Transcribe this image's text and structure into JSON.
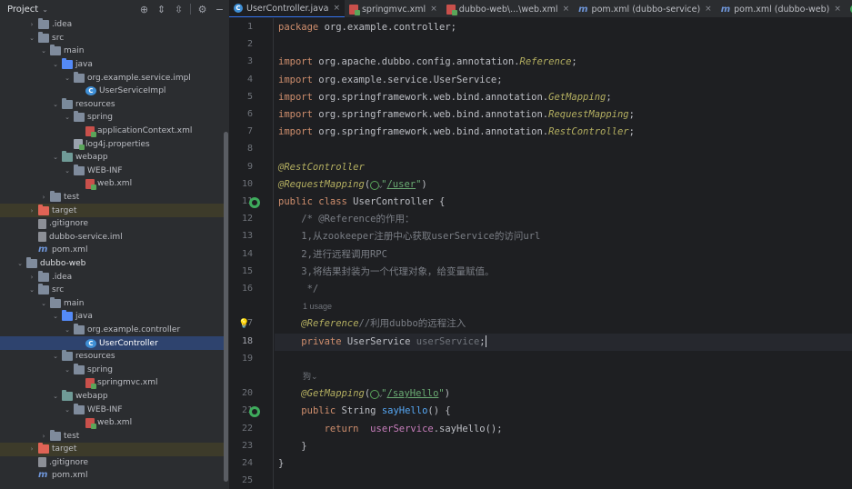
{
  "project_panel": {
    "title": "Project",
    "tree": [
      {
        "label": ".idea",
        "indent": 2,
        "arrow": "›",
        "icon": "folder"
      },
      {
        "label": "src",
        "indent": 2,
        "arrow": "⌄",
        "icon": "folder"
      },
      {
        "label": "main",
        "indent": 3,
        "arrow": "⌄",
        "icon": "folder"
      },
      {
        "label": "java",
        "indent": 4,
        "arrow": "⌄",
        "icon": "folder-blue"
      },
      {
        "label": "org.example.service.impl",
        "indent": 5,
        "arrow": "⌄",
        "icon": "folder"
      },
      {
        "label": "UserServiceImpl",
        "indent": 6,
        "arrow": "",
        "icon": "class"
      },
      {
        "label": "resources",
        "indent": 4,
        "arrow": "⌄",
        "icon": "folder-res"
      },
      {
        "label": "spring",
        "indent": 5,
        "arrow": "⌄",
        "icon": "folder"
      },
      {
        "label": "applicationContext.xml",
        "indent": 6,
        "arrow": "",
        "icon": "xml"
      },
      {
        "label": "log4j.properties",
        "indent": 5,
        "arrow": "",
        "icon": "properties"
      },
      {
        "label": "webapp",
        "indent": 4,
        "arrow": "⌄",
        "icon": "folder-teal"
      },
      {
        "label": "WEB-INF",
        "indent": 5,
        "arrow": "⌄",
        "icon": "folder"
      },
      {
        "label": "web.xml",
        "indent": 6,
        "arrow": "",
        "icon": "xml"
      },
      {
        "label": "test",
        "indent": 3,
        "arrow": "›",
        "icon": "folder"
      },
      {
        "label": "target",
        "indent": 2,
        "arrow": "›",
        "icon": "folder-red",
        "excluded": true
      },
      {
        "label": ".gitignore",
        "indent": 2,
        "arrow": "",
        "icon": "git"
      },
      {
        "label": "dubbo-service.iml",
        "indent": 2,
        "arrow": "",
        "icon": "iml"
      },
      {
        "label": "pom.xml",
        "indent": 2,
        "arrow": "",
        "icon": "maven"
      },
      {
        "label": "dubbo-web",
        "indent": 1,
        "arrow": "⌄",
        "icon": "folder-module",
        "bold": true
      },
      {
        "label": ".idea",
        "indent": 2,
        "arrow": "›",
        "icon": "folder"
      },
      {
        "label": "src",
        "indent": 2,
        "arrow": "⌄",
        "icon": "folder"
      },
      {
        "label": "main",
        "indent": 3,
        "arrow": "⌄",
        "icon": "folder"
      },
      {
        "label": "java",
        "indent": 4,
        "arrow": "⌄",
        "icon": "folder-blue"
      },
      {
        "label": "org.example.controller",
        "indent": 5,
        "arrow": "⌄",
        "icon": "folder"
      },
      {
        "label": "UserController",
        "indent": 6,
        "arrow": "",
        "icon": "class",
        "selected": true
      },
      {
        "label": "resources",
        "indent": 4,
        "arrow": "⌄",
        "icon": "folder-res"
      },
      {
        "label": "spring",
        "indent": 5,
        "arrow": "⌄",
        "icon": "folder"
      },
      {
        "label": "springmvc.xml",
        "indent": 6,
        "arrow": "",
        "icon": "xml"
      },
      {
        "label": "webapp",
        "indent": 4,
        "arrow": "⌄",
        "icon": "folder-teal"
      },
      {
        "label": "WEB-INF",
        "indent": 5,
        "arrow": "⌄",
        "icon": "folder"
      },
      {
        "label": "web.xml",
        "indent": 6,
        "arrow": "",
        "icon": "xml"
      },
      {
        "label": "test",
        "indent": 3,
        "arrow": "›",
        "icon": "folder"
      },
      {
        "label": "target",
        "indent": 2,
        "arrow": "›",
        "icon": "folder-red",
        "excluded": true
      },
      {
        "label": ".gitignore",
        "indent": 2,
        "arrow": "",
        "icon": "git"
      },
      {
        "label": "pom.xml",
        "indent": 2,
        "arrow": "",
        "icon": "maven"
      }
    ]
  },
  "tabs": [
    {
      "label": "UserController.java",
      "icon": "class",
      "active": true
    },
    {
      "label": "springmvc.xml",
      "icon": "xml"
    },
    {
      "label": "dubbo-web\\...\\web.xml",
      "icon": "xml"
    },
    {
      "label": "pom.xml (dubbo-service)",
      "icon": "maven"
    },
    {
      "label": "pom.xml (dubbo-web)",
      "icon": "maven"
    },
    {
      "label": "UserServ",
      "icon": "green"
    }
  ],
  "editor": {
    "lines": [
      {
        "n": "1",
        "html": "<span class='kw'>package</span> org.example.controller;"
      },
      {
        "n": "2",
        "html": ""
      },
      {
        "n": "3",
        "html": "<span class='kw'>import</span> org.apache.dubbo.config.annotation.<span class='imp'>Reference</span>;"
      },
      {
        "n": "4",
        "html": "<span class='kw'>import</span> org.example.service.UserService;"
      },
      {
        "n": "5",
        "html": "<span class='kw'>import</span> org.springframework.web.bind.annotation.<span class='imp'>GetMapping</span>;"
      },
      {
        "n": "6",
        "html": "<span class='kw'>import</span> org.springframework.web.bind.annotation.<span class='imp'>RequestMapping</span>;"
      },
      {
        "n": "7",
        "html": "<span class='kw'>import</span> org.springframework.web.bind.annotation.<span class='imp'>RestController</span>;"
      },
      {
        "n": "8",
        "html": ""
      },
      {
        "n": "9",
        "html": "<span class='ann'>@RestController</span>"
      },
      {
        "n": "10",
        "html": "<span class='ann'>@RequestMapping</span>(<span class='globe'></span><span class='str'>\"</span><span class='strl'>/user</span><span class='str'>\"</span>)"
      },
      {
        "n": "11",
        "html": "<span class='kw'>public class</span> UserController {"
      },
      {
        "n": "12",
        "html": "    <span class='cm'>/* @Reference的作用：</span>"
      },
      {
        "n": "13",
        "html": "    <span class='cm'>1,从zookeeper注册中心获取userService的访问url</span>"
      },
      {
        "n": "14",
        "html": "    <span class='cm'>2,进行远程调用RPC</span>"
      },
      {
        "n": "15",
        "html": "    <span class='cm'>3,将结果封装为一个代理对象，给变量赋值。</span>"
      },
      {
        "n": "16",
        "html": "     <span class='cm'>*/</span>"
      },
      {
        "n": "",
        "html": ""
      },
      {
        "n": "17",
        "html": "    <span class='ann'>@Reference</span><span class='cm'>//利用dubbo的远程注入</span>"
      },
      {
        "n": "18",
        "html": "    <span class='kw'>private</span> UserService <span class='unused'>userService</span>;<span class='caret'></span>"
      },
      {
        "n": "19",
        "html": ""
      },
      {
        "n": "",
        "html": ""
      },
      {
        "n": "20",
        "html": "    <span class='ann'>@GetMapping</span>(<span class='globe'></span><span class='str'>\"</span><span class='strl'>/sayHello</span><span class='str'>\"</span>)"
      },
      {
        "n": "21",
        "html": "    <span class='kw'>public</span> String <span class='fn'>sayHello</span>() {"
      },
      {
        "n": "22",
        "html": "        <span class='kw'>return</span>  <span class='fld'>userService</span>.sayHello();"
      },
      {
        "n": "23",
        "html": "    }"
      },
      {
        "n": "24",
        "html": "}"
      },
      {
        "n": "25",
        "html": ""
      }
    ],
    "usage_hint": "1 usage",
    "author_hint": "狗⌄",
    "current_line": "18"
  },
  "colors": {
    "accent": "#3574f0",
    "background": "#1e1f22",
    "panel": "#2b2d30"
  }
}
